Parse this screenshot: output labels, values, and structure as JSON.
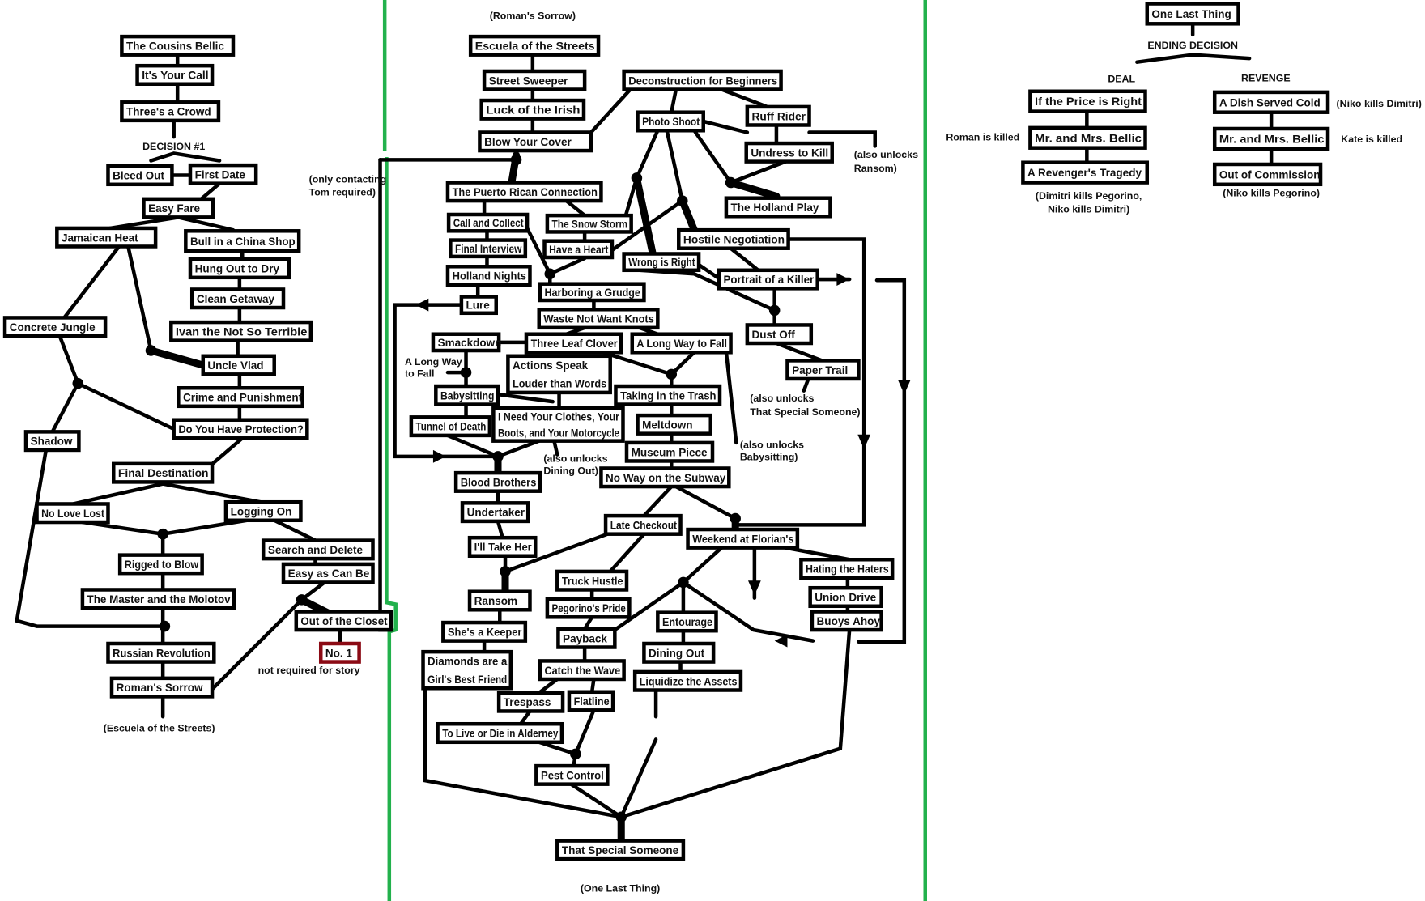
{
  "colors": {
    "deal": "#22b14c",
    "revenge": "#ed1c24",
    "optional_border": "#8b0a14",
    "divider": "#22b14c"
  },
  "nodes": [
    {
      "lines": [
        "The Cousins Bellic"
      ]
    },
    {
      "lines": [
        "It's Your Call"
      ]
    },
    {
      "lines": [
        "Three's a Crowd"
      ]
    },
    {
      "lines": [
        "Bleed Out"
      ]
    },
    {
      "lines": [
        "First Date"
      ]
    },
    {
      "lines": [
        "Easy Fare"
      ]
    },
    {
      "lines": [
        "Jamaican Heat"
      ]
    },
    {
      "lines": [
        "Bull in a China Shop"
      ]
    },
    {
      "lines": [
        "Hung Out to Dry"
      ]
    },
    {
      "lines": [
        "Clean Getaway"
      ]
    },
    {
      "lines": [
        "Ivan the Not So Terrible"
      ]
    },
    {
      "lines": [
        "Uncle Vlad"
      ]
    },
    {
      "lines": [
        "Crime and Punishment"
      ]
    },
    {
      "lines": [
        "Do You Have Protection?"
      ]
    },
    {
      "lines": [
        "Concrete Jungle"
      ]
    },
    {
      "lines": [
        "Shadow"
      ]
    },
    {
      "lines": [
        "Final Destination"
      ]
    },
    {
      "lines": [
        "No Love Lost"
      ]
    },
    {
      "lines": [
        "Logging On"
      ]
    },
    {
      "lines": [
        "Rigged to Blow"
      ]
    },
    {
      "lines": [
        "The Master and the Molotov"
      ]
    },
    {
      "lines": [
        "Search and Delete"
      ]
    },
    {
      "lines": [
        "Easy as Can Be"
      ]
    },
    {
      "lines": [
        "Out of the Closet"
      ]
    },
    {
      "lines": [
        "No. 1"
      ]
    },
    {
      "lines": [
        "Russian Revolution"
      ]
    },
    {
      "lines": [
        "Roman's Sorrow"
      ]
    },
    {
      "lines": [
        "Escuela of the Streets"
      ]
    },
    {
      "lines": [
        "Street Sweeper"
      ]
    },
    {
      "lines": [
        "Luck of the Irish"
      ]
    },
    {
      "lines": [
        "Blow Your Cover"
      ]
    },
    {
      "lines": [
        "Deconstruction for Beginners"
      ]
    },
    {
      "lines": [
        "Photo Shoot"
      ]
    },
    {
      "lines": [
        "Ruff Rider"
      ]
    },
    {
      "lines": [
        "Undress to Kill"
      ]
    },
    {
      "lines": [
        "The Holland Play"
      ]
    },
    {
      "lines": [
        "The Puerto Rican Connection"
      ]
    },
    {
      "lines": [
        "Call and Collect"
      ]
    },
    {
      "lines": [
        "The Snow Storm"
      ]
    },
    {
      "lines": [
        "Final Interview"
      ]
    },
    {
      "lines": [
        "Have a Heart"
      ]
    },
    {
      "lines": [
        "Holland Nights"
      ]
    },
    {
      "lines": [
        "Hostile Negotiation"
      ]
    },
    {
      "lines": [
        "Wrong is Right"
      ]
    },
    {
      "lines": [
        "Portrait of a Killer"
      ]
    },
    {
      "lines": [
        "Harboring a Grudge"
      ]
    },
    {
      "lines": [
        "Lure"
      ]
    },
    {
      "lines": [
        "Waste Not Want Knots"
      ]
    },
    {
      "lines": [
        "Smackdown"
      ]
    },
    {
      "lines": [
        "Three Leaf Clover"
      ]
    },
    {
      "lines": [
        "A Long Way to Fall"
      ]
    },
    {
      "lines": [
        "Dust Off"
      ]
    },
    {
      "lines": [
        "Paper Trail"
      ]
    },
    {
      "lines": [
        "Actions Speak",
        "Louder than Words"
      ]
    },
    {
      "lines": [
        "Babysitting"
      ]
    },
    {
      "lines": [
        "Taking in the Trash"
      ]
    },
    {
      "lines": [
        "Tunnel of Death"
      ]
    },
    {
      "lines": [
        "I Need Your Clothes, Your",
        "Boots, and Your Motorcycle"
      ]
    },
    {
      "lines": [
        "Meltdown"
      ]
    },
    {
      "lines": [
        "Museum Piece"
      ]
    },
    {
      "lines": [
        "Blood Brothers"
      ]
    },
    {
      "lines": [
        "No Way on the Subway"
      ]
    },
    {
      "lines": [
        "Undertaker"
      ]
    },
    {
      "lines": [
        "Late Checkout"
      ]
    },
    {
      "lines": [
        "Weekend at Florian's"
      ]
    },
    {
      "lines": [
        "I'll Take Her"
      ]
    },
    {
      "lines": [
        "Hating the Haters"
      ]
    },
    {
      "lines": [
        "Truck Hustle"
      ]
    },
    {
      "lines": [
        "Union Drive"
      ]
    },
    {
      "lines": [
        "Ransom"
      ]
    },
    {
      "lines": [
        "Pegorino's Pride"
      ]
    },
    {
      "lines": [
        "Buoys Ahoy"
      ]
    },
    {
      "lines": [
        "She's a Keeper"
      ]
    },
    {
      "lines": [
        "Entourage"
      ]
    },
    {
      "lines": [
        "Payback"
      ]
    },
    {
      "lines": [
        "Dining Out"
      ]
    },
    {
      "lines": [
        "Diamonds are a",
        "Girl's Best Friend"
      ]
    },
    {
      "lines": [
        "Catch the Wave"
      ]
    },
    {
      "lines": [
        "Liquidize the Assets"
      ]
    },
    {
      "lines": [
        "Trespass"
      ]
    },
    {
      "lines": [
        "Flatline"
      ]
    },
    {
      "lines": [
        "To Live or Die in Alderney"
      ]
    },
    {
      "lines": [
        "Pest Control"
      ]
    },
    {
      "lines": [
        "That Special Someone"
      ]
    },
    {
      "lines": [
        "One Last Thing"
      ]
    },
    {
      "lines": [
        "If the Price is Right"
      ]
    },
    {
      "lines": [
        "Mr. and Mrs. Bellic"
      ]
    },
    {
      "lines": [
        "A Revenger's Tragedy"
      ]
    },
    {
      "lines": [
        "A Dish Served Cold"
      ]
    },
    {
      "lines": [
        "Mr. and Mrs. Bellic"
      ]
    },
    {
      "lines": [
        "Out of Commission"
      ]
    }
  ],
  "notes": [
    {
      "lines": [
        "DECISION #1"
      ],
      "color": "#111111"
    },
    {
      "lines": [
        "(Escuela of the Streets)"
      ],
      "color": "#111111"
    },
    {
      "lines": [
        "not required for story"
      ],
      "color": "#111111"
    },
    {
      "lines": [
        "(only contacting",
        "Tom required)"
      ],
      "color": "#111111"
    },
    {
      "lines": [
        "(Roman's Sorrow)"
      ],
      "color": "#111111"
    },
    {
      "lines": [
        "(also unlocks",
        "Ransom)"
      ],
      "color": "#111111"
    },
    {
      "lines": [
        "A Long Way",
        "to Fall"
      ],
      "color": "#111111"
    },
    {
      "lines": [
        "(also unlocks",
        "That Special Someone)"
      ],
      "color": "#111111"
    },
    {
      "lines": [
        "(also unlocks",
        "Babysitting)"
      ],
      "color": "#111111"
    },
    {
      "lines": [
        "(also unlocks",
        "Dining Out)"
      ],
      "color": "#111111"
    },
    {
      "lines": [
        "(One Last Thing)"
      ],
      "color": "#111111"
    },
    {
      "lines": [
        "ENDING DECISION"
      ],
      "color": "#111111"
    },
    {
      "lines": [
        "DEAL"
      ],
      "color": "#22b14c"
    },
    {
      "lines": [
        "REVENGE"
      ],
      "color": "#ed1c24"
    },
    {
      "lines": [
        "Roman is killed"
      ],
      "color": "#22b14c"
    },
    {
      "lines": [
        "(Dimitri kills Pegorino,",
        "Niko kills Dimitri)"
      ],
      "color": "#22b14c"
    },
    {
      "lines": [
        "(Niko kills Dimitri)"
      ],
      "color": "#ed1c24"
    },
    {
      "lines": [
        "Kate is killed"
      ],
      "color": "#ed1c24"
    },
    {
      "lines": [
        "(Niko kills Pegorino)"
      ],
      "color": "#ed1c24"
    }
  ]
}
